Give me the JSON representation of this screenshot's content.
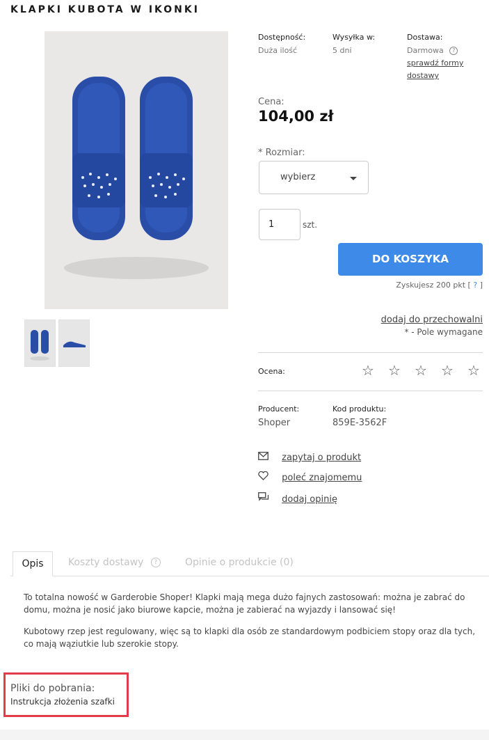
{
  "product": {
    "title": "KLAPKI KUBOTA W IKONKI",
    "availability_label": "Dostępność:",
    "availability_value": "Duża ilość",
    "shipping_label": "Wysyłka w:",
    "shipping_value": "5 dni",
    "delivery_label": "Dostawa:",
    "delivery_value": "Darmowa",
    "delivery_link_1": "sprawdź formy",
    "delivery_link_2": "dostawy",
    "price_label": "Cena:",
    "price": "104,00 zł",
    "size_label": "* Rozmiar:",
    "size_selected": "wybierz",
    "quantity": "1",
    "unit": "szt.",
    "cart_button": "DO KOSZYKA",
    "points_text": "Zyskujesz 200 pkt [",
    "points_q": "?",
    "points_close": "]",
    "store_link": "dodaj do przechowalni",
    "required_note": "* - Pole wymagane",
    "rating_label": "Ocena:",
    "producer_label": "Producent:",
    "producer_value": "Shoper",
    "code_label": "Kod produktu:",
    "code_value": "859E-3562F",
    "ask_link": "zapytaj o produkt",
    "recommend_link": "poleć znajomemu",
    "review_link": "dodaj opinię"
  },
  "icons": {
    "rating_star": "☆",
    "help": "?",
    "mail": "mail-icon",
    "heart": "heart-icon",
    "chat": "chat-icon"
  },
  "tabs": [
    {
      "label": "Opis"
    },
    {
      "label": "Koszty dostawy"
    },
    {
      "label": "Opinie o produkcie (0)"
    }
  ],
  "description": {
    "p1": "To totalna nowość w  Garderobie Shoper! Klapki mają mega dużo fajnych zastosowań: można je zabrać do domu, można je nosić jako biurowe kapcie, można je zabierać na wyjazdy i lansować się!",
    "p2": "Kubotowy rzep jest regulowany, więc są to klapki dla osób ze standardowym podbiciem stopy oraz dla tych, co mają wąziutkie lub szerokie stopy."
  },
  "downloads": {
    "label": "Pliki do pobrania:",
    "file": "Instrukcja złożenia szafki"
  },
  "colors": {
    "accent": "#3d8ae8",
    "highlight_border": "#e23b4a",
    "slipper_blue": "#2a4da8"
  }
}
